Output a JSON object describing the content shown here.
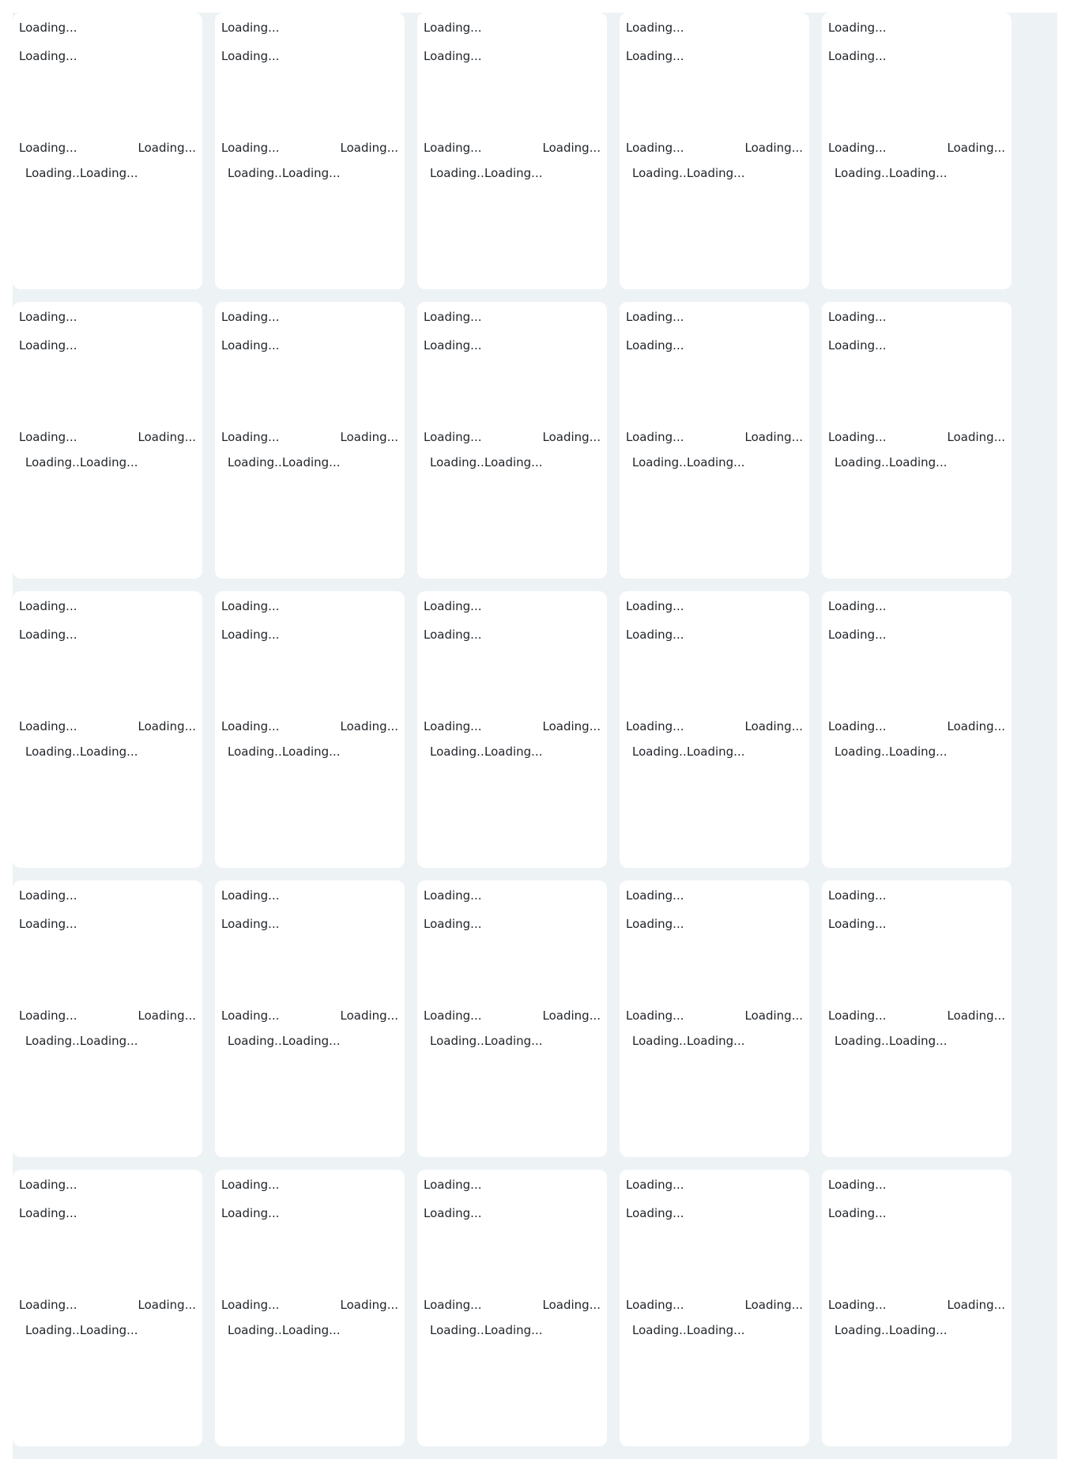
{
  "grid": {
    "columns": 5,
    "rows": 5,
    "card": {
      "title": "Loading...",
      "subtitle": "Loading...",
      "meta_left": "Loading...",
      "meta_right": "Loading...",
      "tag_a": "Loading...",
      "tag_b": "Loading..."
    }
  },
  "colors": {
    "page_background": "#edf2f5",
    "card_background": "#ffffff",
    "text": "#1f2328"
  }
}
